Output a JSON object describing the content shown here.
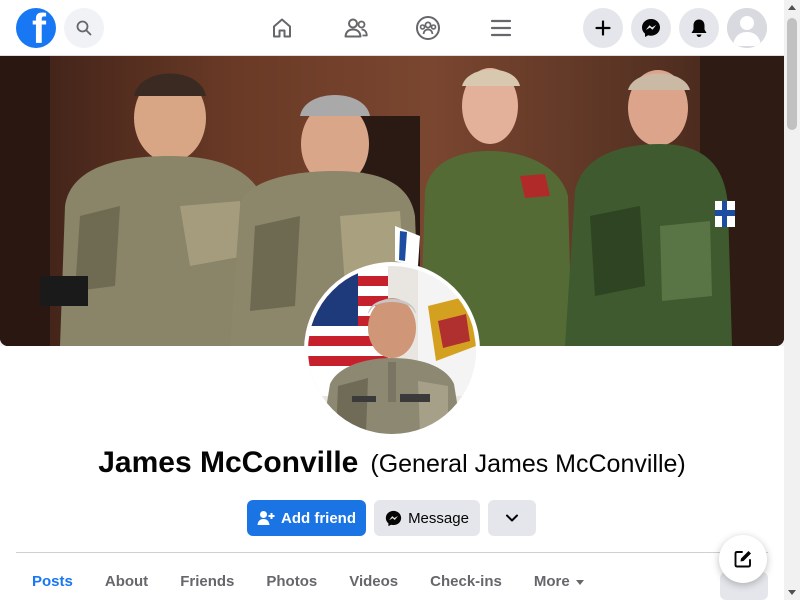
{
  "topbar": {
    "logo_letter": "f",
    "nav_icons": [
      "home-icon",
      "friends-icon",
      "groups-icon",
      "menu-icon"
    ],
    "right_icons": [
      "plus-icon",
      "messenger-icon",
      "bell-icon",
      "avatar"
    ]
  },
  "profile": {
    "name": "James McConville",
    "alternate_name": "(General James McConville)"
  },
  "actions": {
    "add_friend": "Add friend",
    "message": "Message"
  },
  "tabs": [
    {
      "label": "Posts",
      "active": true
    },
    {
      "label": "About"
    },
    {
      "label": "Friends"
    },
    {
      "label": "Photos"
    },
    {
      "label": "Videos"
    },
    {
      "label": "Check-ins"
    },
    {
      "label": "More"
    }
  ],
  "colors": {
    "brand": "#1877f2",
    "primary_button": "#1b74e4",
    "secondary_button": "#e4e6eb",
    "text": "#050505",
    "muted_text": "#65676b"
  }
}
